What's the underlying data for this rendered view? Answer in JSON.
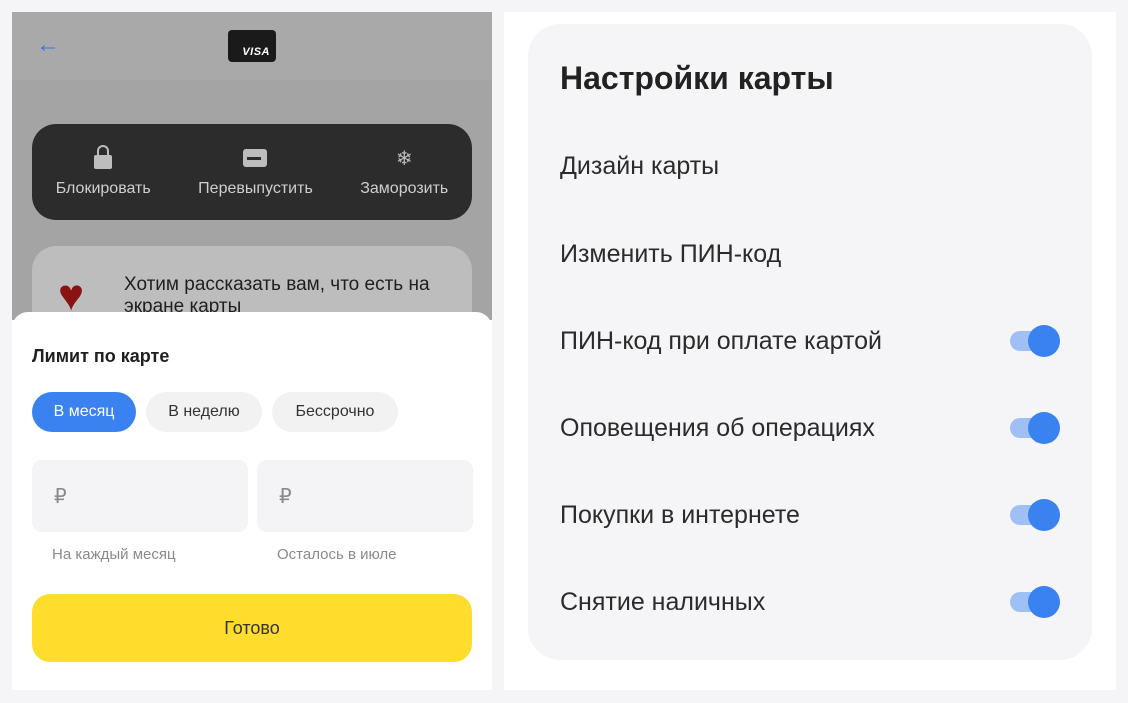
{
  "left": {
    "header": {
      "back_icon": "arrow-left-icon",
      "card_brand": "VISA"
    },
    "actions": [
      {
        "label": "Блокировать",
        "icon": "lock-icon"
      },
      {
        "label": "Перевыпустить",
        "icon": "card-reissue-icon"
      },
      {
        "label": "Заморозить",
        "icon": "snowflake-icon"
      }
    ],
    "promo": {
      "text": "Хотим рассказать вам, что есть на экране карты",
      "icon": "heart-icon"
    },
    "sheet": {
      "title": "Лимит по карте",
      "chips": [
        {
          "label": "В месяц",
          "active": true
        },
        {
          "label": "В неделю",
          "active": false
        },
        {
          "label": "Бессрочно",
          "active": false
        }
      ],
      "currency": "₽",
      "fields": [
        {
          "hint": "На каждый месяц"
        },
        {
          "hint": "Осталось в июле"
        }
      ],
      "done_label": "Готово"
    }
  },
  "right": {
    "title": "Настройки карты",
    "items": [
      {
        "label": "Дизайн карты",
        "toggle": null
      },
      {
        "label": "Изменить ПИН-код",
        "toggle": null
      },
      {
        "label": "ПИН-код при оплате картой",
        "toggle": true
      },
      {
        "label": "Оповещения об операциях",
        "toggle": true
      },
      {
        "label": "Покупки в интернете",
        "toggle": true
      },
      {
        "label": "Снятие наличных",
        "toggle": true
      }
    ]
  },
  "colors": {
    "accent": "#3a82f0",
    "button": "#ffdd2d",
    "dark_panel": "#2c2c2c"
  }
}
